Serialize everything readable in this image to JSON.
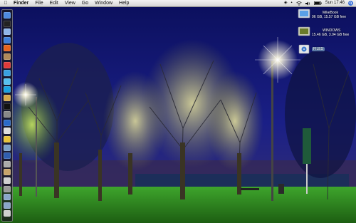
{
  "menubar": {
    "apple_icon": "apple-icon",
    "app_name": "Finder",
    "items": [
      "File",
      "Edit",
      "View",
      "Go",
      "Window",
      "Help"
    ],
    "clock": "Sun 17:46",
    "status_icons": [
      "wifi-icon",
      "volume-icon",
      "battery-icon",
      "search-icon"
    ]
  },
  "desktop": {
    "items": [
      {
        "name": "MikeBook",
        "detail": "96 GB, 15.57 GB free",
        "icon": "hard-drive-icon"
      },
      {
        "name": "WINDOWS",
        "detail": "15.46 GB, 3.94 GB free",
        "icon": "hard-drive-icon"
      },
      {
        "name": "FILES",
        "detail": "",
        "icon": "disk-icon"
      }
    ]
  },
  "dock": {
    "icons": [
      {
        "name": "finder-icon",
        "color": "#4d8be0"
      },
      {
        "name": "dashboard-icon",
        "color": "#222"
      },
      {
        "name": "mail-icon",
        "color": "#8fb6e8"
      },
      {
        "name": "safari-icon",
        "color": "#3d7fd9"
      },
      {
        "name": "firefox-icon",
        "color": "#e6641e"
      },
      {
        "name": "address-book-icon",
        "color": "#b08a5a"
      },
      {
        "name": "ical-icon",
        "color": "#e03a3a"
      },
      {
        "name": "itunes-icon",
        "color": "#39a0e0"
      },
      {
        "name": "ichat-icon",
        "color": "#57c0f0"
      },
      {
        "name": "skype-icon",
        "color": "#1aa2e2"
      },
      {
        "name": "photo-icon",
        "color": "#d4a84a"
      },
      {
        "name": "terminal-icon",
        "color": "#111"
      },
      {
        "name": "system-preferences-icon",
        "color": "#888"
      },
      {
        "name": "network-icon",
        "color": "#2a6ac9"
      },
      {
        "name": "text-edit-icon",
        "color": "#ddd"
      },
      {
        "name": "chrome-icon",
        "color": "#e6c23a"
      },
      {
        "name": "preview-icon",
        "color": "#7aa0c8"
      },
      {
        "name": "quicktime-icon",
        "color": "#2f5fb0"
      },
      {
        "name": "disk-utility-icon",
        "color": "#aaa"
      },
      {
        "name": "app-folder-icon",
        "color": "#c8a46a"
      },
      {
        "name": "script-icon",
        "color": "#d0d0d0"
      },
      {
        "name": "utility-icon",
        "color": "#999"
      },
      {
        "name": "downloads-folder-icon",
        "color": "#8aa6c9"
      },
      {
        "name": "documents-folder-icon",
        "color": "#8aa6c9"
      },
      {
        "name": "trash-icon",
        "color": "#cfcfcf"
      }
    ]
  }
}
